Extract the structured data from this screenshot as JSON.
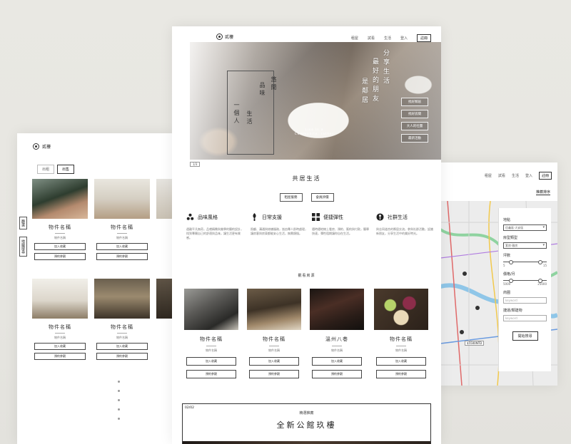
{
  "colors": {
    "ink": "#222222",
    "background": "#e8e7e2",
    "card": "#ffffff"
  },
  "left_page": {
    "logo_text": "貳樓",
    "tabs": [
      "出租",
      "出售"
    ],
    "side_tabs": [
      "篩選",
      "地圖搜尋"
    ],
    "cards": [
      {
        "name": "物件名稱",
        "sub": "物件名稱",
        "buttons": [
          "加入收藏",
          "預約參觀"
        ]
      },
      {
        "name": "物件名稱",
        "sub": "物件名稱",
        "buttons": [
          "加入收藏",
          "預約參觀"
        ]
      },
      {
        "name": "物件名稱",
        "sub": "物件名稱",
        "buttons": [
          "加入收藏",
          "預約參觀"
        ]
      },
      {
        "name": "物件名稱",
        "sub": "物件名稱",
        "buttons": [
          "加入收藏",
          "預約參觀"
        ]
      }
    ]
  },
  "center_page": {
    "logo_text": "貳樓",
    "nav": [
      "租屋",
      "試看",
      "生活",
      "登入",
      "註冊"
    ],
    "hero": {
      "vertical_left": [
        "一個人",
        "生活",
        "品味",
        "悠閒"
      ],
      "vertical_right": [
        "分享生活",
        "最好的朋友",
        "是鄰居"
      ],
      "tagline": [
        "Live In a",
        "Community, rather"
      ],
      "side_buttons": [
        "找好鄰居",
        "找好房間",
        "大人的社團",
        "最新活動"
      ],
      "caption": "1/3"
    },
    "section_title": "共居生活",
    "section_buttons": [
      "租屋服務",
      "會員評價"
    ],
    "features": [
      {
        "title": "品味風格",
        "text": "遠離平凡無奇，品嚐精緻與美學的簡約設計，找到專屬自己的舒適與品味，讓生活更有質感。"
      },
      {
        "title": "日常支援",
        "text": "照顧、溝通與修繕服務，皆由專人即時處理，讓房客與房東都能安心生活，無需煩惱。"
      },
      {
        "title": "便捷彈性",
        "text": "隨時隨地線上看房、預約、簽約與付款，簡單快速，彈性租期讓你自在生活。"
      },
      {
        "title": "社群生活",
        "text": "與志同道合的鄰居交流，參與社群活動，認識新朋友，分享生活中的美好時光。"
      }
    ],
    "listings_title": "觀看房源",
    "listings": [
      {
        "name": "物件名稱",
        "sub": "物件名稱",
        "buttons": [
          "加入收藏",
          "預約參觀"
        ]
      },
      {
        "name": "物件名稱",
        "sub": "物件名稱",
        "buttons": [
          "加入收藏",
          "預約參觀"
        ]
      },
      {
        "name": "溫州八巷",
        "sub": "物件名稱",
        "buttons": [
          "加入收藏",
          "預約參觀"
        ]
      },
      {
        "name": "物件名稱",
        "sub": "物件名稱",
        "buttons": [
          "加入收藏",
          "預約參觀"
        ]
      }
    ],
    "promo": {
      "num": "02/02",
      "small": "精選推薦",
      "big": "全新公館玖樓"
    }
  },
  "right_page": {
    "nav": [
      "租屋",
      "試看",
      "生活",
      "登入",
      "註冊"
    ],
    "map_sort": "推薦排序",
    "filter": {
      "area_label": "地點",
      "area_value": "信義區·大安區",
      "type_label": "房型類型",
      "type_value": "套房·雅房",
      "floor_label": "坪數",
      "floor_range": [
        "5",
        "15"
      ],
      "price_label": "價格/月",
      "price_range": [
        "5000",
        "25000"
      ],
      "nearby_label": "商圈",
      "nearby_placeholder": "keyword",
      "mrt_label": "捷運/鄰建物",
      "mrt_placeholder": "keyword",
      "submit": "開始搜尋"
    }
  }
}
